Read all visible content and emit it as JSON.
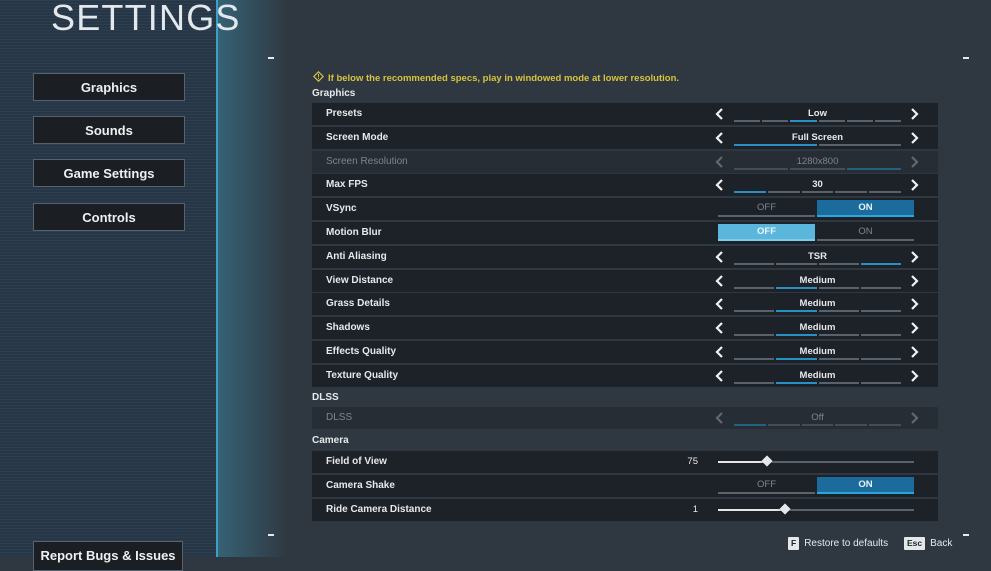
{
  "title": "SETTINGS",
  "sidebar": {
    "items": [
      {
        "label": "Graphics"
      },
      {
        "label": "Sounds"
      },
      {
        "label": "Game Settings"
      },
      {
        "label": "Controls"
      }
    ],
    "report_label": "Report Bugs & Issues"
  },
  "warning": {
    "icon": "warning-diamond-icon",
    "text": "If below the recommended specs, play in windowed mode at lower resolution."
  },
  "colors": {
    "accent": "#2a8fc4",
    "toggle_selected": "#1b6c9c",
    "toggle_focused": "#5ab6da",
    "warning": "#d6c43c",
    "divider": "#3ca0c8"
  },
  "graphics": {
    "heading": "Graphics",
    "rows": [
      {
        "label": "Presets",
        "type": "spinner",
        "value": "Low",
        "options_count": 6,
        "selected_index": 2
      },
      {
        "label": "Screen Mode",
        "type": "spinner",
        "value": "Full Screen",
        "options_count": 2,
        "selected_index": 0
      },
      {
        "label": "Screen Resolution",
        "type": "spinner",
        "value": "1280x800",
        "options_count": 3,
        "selected_index": 2,
        "disabled": true
      },
      {
        "label": "Max FPS",
        "type": "spinner",
        "value": "30",
        "options_count": 5,
        "selected_index": 0
      },
      {
        "label": "VSync",
        "type": "toggle",
        "off_label": "OFF",
        "on_label": "ON",
        "value": "ON"
      },
      {
        "label": "Motion Blur",
        "type": "toggle",
        "off_label": "OFF",
        "on_label": "ON",
        "value": "OFF",
        "focused": true
      },
      {
        "label": "Anti Aliasing",
        "type": "spinner",
        "value": "TSR",
        "options_count": 4,
        "selected_index": 3
      },
      {
        "label": "View Distance",
        "type": "spinner",
        "value": "Medium",
        "options_count": 4,
        "selected_index": 1
      },
      {
        "label": "Grass Details",
        "type": "spinner",
        "value": "Medium",
        "options_count": 4,
        "selected_index": 1
      },
      {
        "label": "Shadows",
        "type": "spinner",
        "value": "Medium",
        "options_count": 4,
        "selected_index": 1
      },
      {
        "label": "Effects Quality",
        "type": "spinner",
        "value": "Medium",
        "options_count": 4,
        "selected_index": 1
      },
      {
        "label": "Texture Quality",
        "type": "spinner",
        "value": "Medium",
        "options_count": 4,
        "selected_index": 1
      }
    ]
  },
  "dlss": {
    "heading": "DLSS",
    "rows": [
      {
        "label": "DLSS",
        "type": "spinner",
        "value": "Off",
        "options_count": 5,
        "selected_index": 0,
        "disabled": true
      }
    ]
  },
  "camera": {
    "heading": "Camera",
    "rows": [
      {
        "label": "Field of View",
        "type": "slider",
        "value": "75",
        "position": 0.25
      },
      {
        "label": "Camera Shake",
        "type": "toggle",
        "off_label": "OFF",
        "on_label": "ON",
        "value": "ON"
      },
      {
        "label": "Ride Camera Distance",
        "type": "slider",
        "value": "1",
        "position": 0.34
      }
    ]
  },
  "footer": {
    "restore_key": "F",
    "restore_label": "Restore to defaults",
    "back_key": "Esc",
    "back_label": "Back"
  }
}
